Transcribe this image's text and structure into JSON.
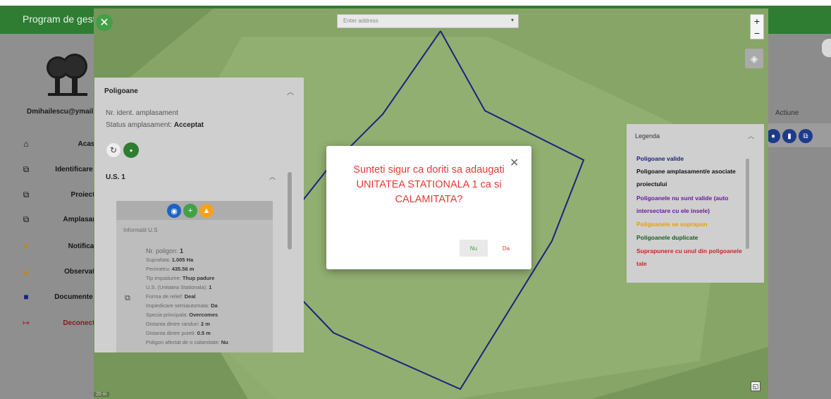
{
  "app": {
    "title": "Program de gest",
    "user_email": "Dmihailescu@ymail"
  },
  "sidebar": {
    "items": [
      {
        "label": "Acasa",
        "icon": "home-icon"
      },
      {
        "label": "Identificare a",
        "icon": "polygon-select-icon"
      },
      {
        "label": "Proiecte",
        "icon": "polygon-select-icon"
      },
      {
        "label": "Amplasam",
        "icon": "polygon-select-icon"
      },
      {
        "label": "Notificari",
        "icon": "bell-icon"
      },
      {
        "label": "Observatii",
        "icon": "warning-icon"
      },
      {
        "label": "Documente c",
        "icon": "document-icon"
      },
      {
        "label": "Deconecta",
        "icon": "logout-icon"
      }
    ]
  },
  "table": {
    "action_header": "Actiune"
  },
  "map": {
    "address_placeholder": "Enter address",
    "zoom_in": "+",
    "zoom_out": "−",
    "scale_label": "20 m"
  },
  "polygons_panel": {
    "title": "Poligoane",
    "site_id_label": "Nr. ident. amplasament",
    "status_label": "Status amplasament:",
    "status_value": "Acceptat",
    "unit_title": "U.S. 1",
    "info_label": "Informatii U.S",
    "details": [
      {
        "label": "Nr. poligon:",
        "value": "1"
      },
      {
        "label": "Suprafata:",
        "value": "1.005 Ha"
      },
      {
        "label": "Perimetru:",
        "value": "435.56 m"
      },
      {
        "label": "Tip impadurire:",
        "value": "Thup padure"
      },
      {
        "label": "U.S. (Unitatea Stationala):",
        "value": "1"
      },
      {
        "label": "Forma de relief:",
        "value": "Deal"
      },
      {
        "label": "Impiedicare semiautomata:",
        "value": "Da"
      },
      {
        "label": "Specia principala:",
        "value": "Overcomes"
      },
      {
        "label": "Distanta dintre randuri:",
        "value": "2 m"
      },
      {
        "label": "Distanta dintre puieti:",
        "value": "0.5 m"
      },
      {
        "label": "Poligon afectat de o calamitate:",
        "value": "Nu"
      }
    ]
  },
  "legend": {
    "title": "Legenda",
    "items": [
      {
        "label": "Poligoane valide",
        "color": "#1a237e"
      },
      {
        "label": "Poligoane amplasament/e asociate proiectului",
        "color": "#111111"
      },
      {
        "label": "Poligoanele nu sunt valide (auto intersectare cu ele insele)",
        "color": "#6a1b9a"
      },
      {
        "label": "Poligoanele se suprapun",
        "color": "#e6a100"
      },
      {
        "label": "Poligoanele duplicate",
        "color": "#1b5e20"
      },
      {
        "label": "Suprapunere cu unul din poligoanele tale",
        "color": "#c62828"
      }
    ]
  },
  "dialog": {
    "message": "Sunteti sigur ca doriti sa adaugati UNITATEA STATIONALA 1 ca si CALAMITATA?",
    "no_label": "Nu",
    "yes_label": "Da"
  },
  "colors": {
    "brand_green": "#2e7d32",
    "polygon_blue": "#1a237e",
    "danger_red": "#e53935"
  }
}
